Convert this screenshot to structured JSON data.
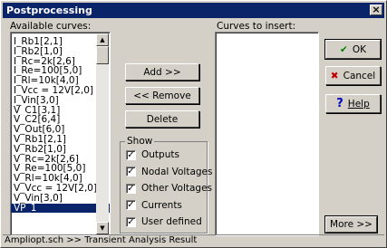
{
  "window": {
    "title": "Postprocessing",
    "close_glyph": "×"
  },
  "labels": {
    "available": "Available curves:",
    "insert": "Curves to insert:"
  },
  "available_curves": [
    "I_Rb1[2,1]",
    "I_Rb2[1,0]",
    "I_Rc=2k[2,6]",
    "I_Re=100[5,0]",
    "I_Rl=10k[4,0]",
    "I_Vcc = 12V[2,0]",
    "I_Vin[3,0]",
    "V_C1[3,1]",
    "V_C2[6,4]",
    "V_Out[6,0]",
    "V_Rb1[2,1]",
    "V_Rb2[1,0]",
    "V_Rc=2k[2,6]",
    "V_Re=100[5,0]",
    "V_Rl=10k[4,0]",
    "V_Vcc = 12V[2,0]",
    "V_Vin[3,0]",
    "VP_1"
  ],
  "selected_index": 17,
  "buttons": {
    "add": "Add >>",
    "remove": "<< Remove",
    "delete": "Delete",
    "ok": "OK",
    "cancel": "Cancel",
    "help": "Help",
    "more": "More >>"
  },
  "icons": {
    "ok": "check-icon",
    "cancel": "x-icon",
    "help": "question-icon"
  },
  "show": {
    "title": "Show",
    "options": [
      {
        "label": "Outputs",
        "checked": true
      },
      {
        "label": "Nodal Voltages",
        "checked": true
      },
      {
        "label": "Other Voltages",
        "checked": true
      },
      {
        "label": "Currents",
        "checked": true
      },
      {
        "label": "User defined",
        "checked": true
      }
    ]
  },
  "status": "Ampliopt.sch >> Transient Analysis Result",
  "colors": {
    "titlebar": "#0a246a",
    "ok_check": "#008000",
    "cancel_x": "#c00000",
    "help_q": "#0000c0"
  }
}
